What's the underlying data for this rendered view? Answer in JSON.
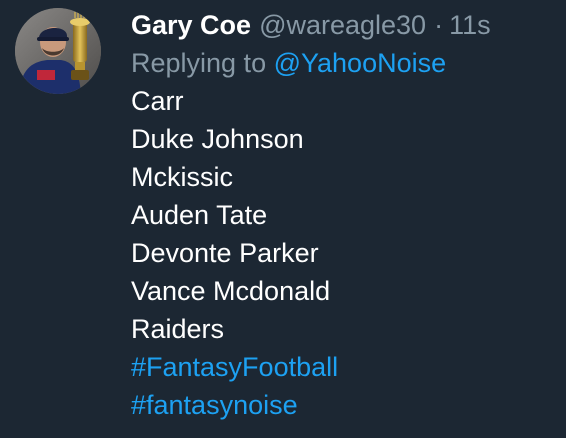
{
  "colors": {
    "background": "#1c2733",
    "text_primary": "#ffffff",
    "text_secondary": "#8899a6",
    "link": "#1da1f2"
  },
  "tweet": {
    "avatar_icon": "user-avatar-with-trophy",
    "display_name": "Gary Coe",
    "handle": "@wareagle30",
    "separator": "·",
    "timestamp": "11s",
    "replying_to_label": "Replying to",
    "replying_to_handle": "@YahooNoise",
    "lines": [
      "Carr",
      "Duke Johnson",
      "Mckissic",
      "Auden Tate",
      "Devonte Parker",
      "Vance Mcdonald",
      "Raiders"
    ],
    "hashtags": [
      "#FantasyFootball",
      "#fantasynoise"
    ]
  }
}
